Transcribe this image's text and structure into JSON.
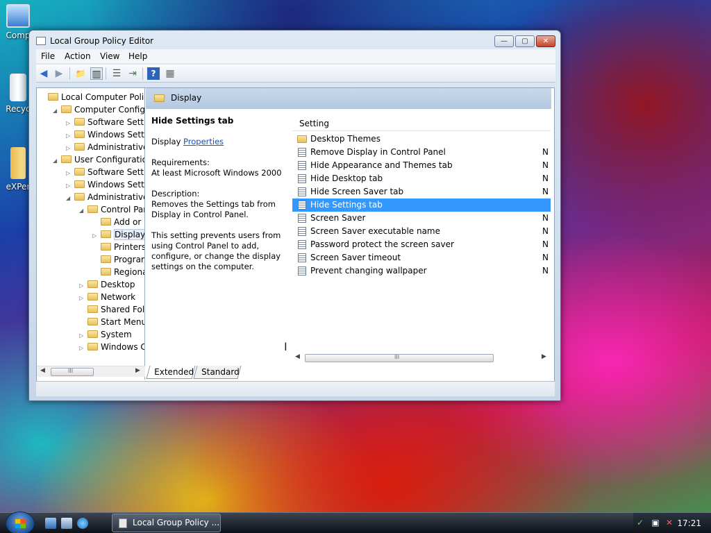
{
  "desktop": {
    "icons": [
      {
        "label": "Comp"
      },
      {
        "label": "Recyc"
      },
      {
        "label": "eXPer"
      }
    ]
  },
  "window": {
    "title": "Local Group Policy Editor",
    "controls": {
      "minimize": "—",
      "maximize": "▢",
      "close": "✕"
    }
  },
  "menubar": {
    "items": [
      "File",
      "Action",
      "View",
      "Help"
    ]
  },
  "toolbar": {
    "icons": [
      "back-icon",
      "forward-icon",
      "up-folder-icon",
      "show-hide-tree-icon",
      "properties-icon",
      "export-list-icon",
      "help-icon",
      "filter-icon"
    ],
    "glyphs": [
      "◀",
      "▶",
      "📁",
      "▥",
      "☰",
      "⇥",
      "?",
      "▦"
    ]
  },
  "tree": {
    "nodes": [
      {
        "label": "Local Computer Policy",
        "level": 0,
        "expander": ""
      },
      {
        "label": "Computer Configura",
        "level": 1,
        "expander": "◢"
      },
      {
        "label": "Software Settings",
        "level": 2,
        "expander": "▷"
      },
      {
        "label": "Windows Setting",
        "level": 2,
        "expander": "▷"
      },
      {
        "label": "Administrative Te",
        "level": 2,
        "expander": "▷"
      },
      {
        "label": "User Configuration",
        "level": 1,
        "expander": "◢"
      },
      {
        "label": "Software Settings",
        "level": 2,
        "expander": "▷"
      },
      {
        "label": "Windows Setting",
        "level": 2,
        "expander": "▷"
      },
      {
        "label": "Administrative Te",
        "level": 2,
        "expander": "◢"
      },
      {
        "label": "Control Panel",
        "level": 3,
        "expander": "◢"
      },
      {
        "label": "Add or Re",
        "level": 4,
        "expander": ""
      },
      {
        "label": "Display",
        "level": 4,
        "expander": "▷"
      },
      {
        "label": "Printers",
        "level": 4,
        "expander": ""
      },
      {
        "label": "Programs",
        "level": 4,
        "expander": ""
      },
      {
        "label": "Regional a",
        "level": 4,
        "expander": ""
      },
      {
        "label": "Desktop",
        "level": 3,
        "expander": "▷"
      },
      {
        "label": "Network",
        "level": 3,
        "expander": "▷"
      },
      {
        "label": "Shared Folder",
        "level": 3,
        "expander": ""
      },
      {
        "label": "Start Menu ar",
        "level": 3,
        "expander": ""
      },
      {
        "label": "System",
        "level": 3,
        "expander": "▷"
      },
      {
        "label": "Windows Cor",
        "level": 3,
        "expander": "▷"
      }
    ],
    "selected_label": "Display",
    "scroll": {
      "left": "◀",
      "right": "▶",
      "grip": "III"
    }
  },
  "detail": {
    "header": "Display",
    "title": "Hide Settings tab",
    "setting_prefix": "Display",
    "properties_link": "Properties",
    "requirements_label": "Requirements:",
    "requirements_value": "At least Microsoft Windows 2000",
    "description_label": "Description:",
    "description_text": "Removes the Settings tab from Display in Control Panel.",
    "description_more": "This setting prevents users from using Control Panel to add, configure, or change the display settings on the computer."
  },
  "list": {
    "column_header": "Setting",
    "rows": [
      {
        "label": "Desktop Themes",
        "type": "folder",
        "state": ""
      },
      {
        "label": "Remove Display in Control Panel",
        "type": "setting",
        "state": "N"
      },
      {
        "label": "Hide Appearance and Themes tab",
        "type": "setting",
        "state": "N"
      },
      {
        "label": "Hide Desktop tab",
        "type": "setting",
        "state": "N"
      },
      {
        "label": "Hide Screen Saver tab",
        "type": "setting",
        "state": "N"
      },
      {
        "label": "Hide Settings tab",
        "type": "setting",
        "state": ""
      },
      {
        "label": "Screen Saver",
        "type": "setting",
        "state": "N"
      },
      {
        "label": "Screen Saver executable name",
        "type": "setting",
        "state": "N"
      },
      {
        "label": "Password protect the screen saver",
        "type": "setting",
        "state": "N"
      },
      {
        "label": "Screen Saver timeout",
        "type": "setting",
        "state": "N"
      },
      {
        "label": "Prevent changing wallpaper",
        "type": "setting",
        "state": "N"
      }
    ],
    "selected_label": "Hide Settings tab",
    "scroll": {
      "left": "◀",
      "right": "▶",
      "grip": "III"
    }
  },
  "tabs": [
    "Extended",
    "Standard"
  ],
  "taskbar": {
    "task_label": "Local Group Policy ...",
    "clock": "17:21",
    "tray_icons": [
      "shield-icon",
      "network-icon",
      "volume-muted-icon"
    ],
    "tray_glyphs": [
      "✓",
      "▣",
      "✕"
    ]
  },
  "colors": {
    "selection": "#3399ff",
    "link": "#1552a8"
  }
}
